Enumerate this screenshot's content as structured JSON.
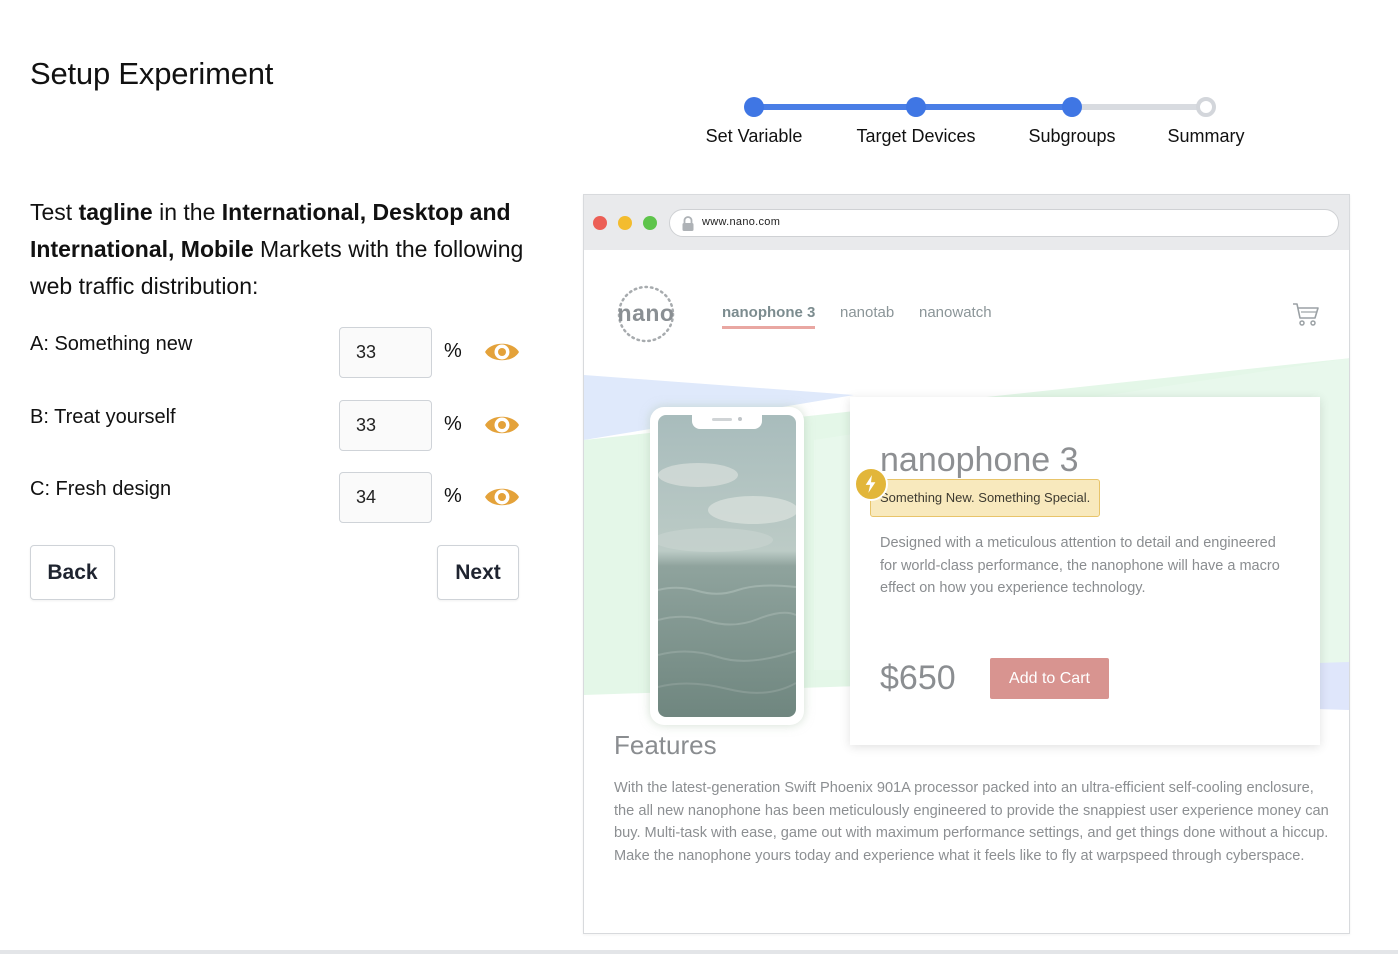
{
  "page": {
    "title": "Setup Experiment"
  },
  "stepper": {
    "steps": [
      {
        "label": "Set Variable",
        "state": "completed"
      },
      {
        "label": "Target Devices",
        "state": "completed"
      },
      {
        "label": "Subgroups",
        "state": "current"
      },
      {
        "label": "Summary",
        "state": "upcoming"
      }
    ],
    "accent_color": "#3f76e4"
  },
  "description": {
    "prefix": "Test ",
    "variable": "tagline",
    "middle": " in the ",
    "markets": "International, Desktop and International, Mobile",
    "suffix": " Markets with the following web traffic distribution:"
  },
  "variants": [
    {
      "label": "A: Something new",
      "value": "33",
      "unit": "%",
      "icon": "eye-icon"
    },
    {
      "label": "B: Treat yourself",
      "value": "33",
      "unit": "%",
      "icon": "eye-icon"
    },
    {
      "label": "C: Fresh design",
      "value": "34",
      "unit": "%",
      "icon": "eye-icon"
    }
  ],
  "buttons": {
    "back": "Back",
    "next": "Next"
  },
  "preview": {
    "url": "www.nano.com",
    "logo": "nano",
    "nav": [
      "nanophone 3",
      "nanotab",
      "nanowatch"
    ],
    "nav_active": "nanophone 3",
    "product": {
      "name": "nanophone 3",
      "tagline": "Something New. Something Special.",
      "description": "Designed with a meticulous attention to detail and engineered for world-class performance, the nanophone will have a macro effect on how you experience technology.",
      "price": "$650",
      "add_to_cart": "Add to Cart"
    },
    "features": {
      "title": "Features",
      "text": "With the latest-generation Swift Phoenix 901A processor packed into an ultra-efficient self-cooling enclosure, the all new nanophone has been meticulously engineered to provide the snappiest user experience money can buy. Multi-task with ease, game out with maximum performance settings, and get things done without a hiccup. Make the nanophone yours today and experience what it feels like to fly at warpspeed through cyberspace."
    }
  }
}
